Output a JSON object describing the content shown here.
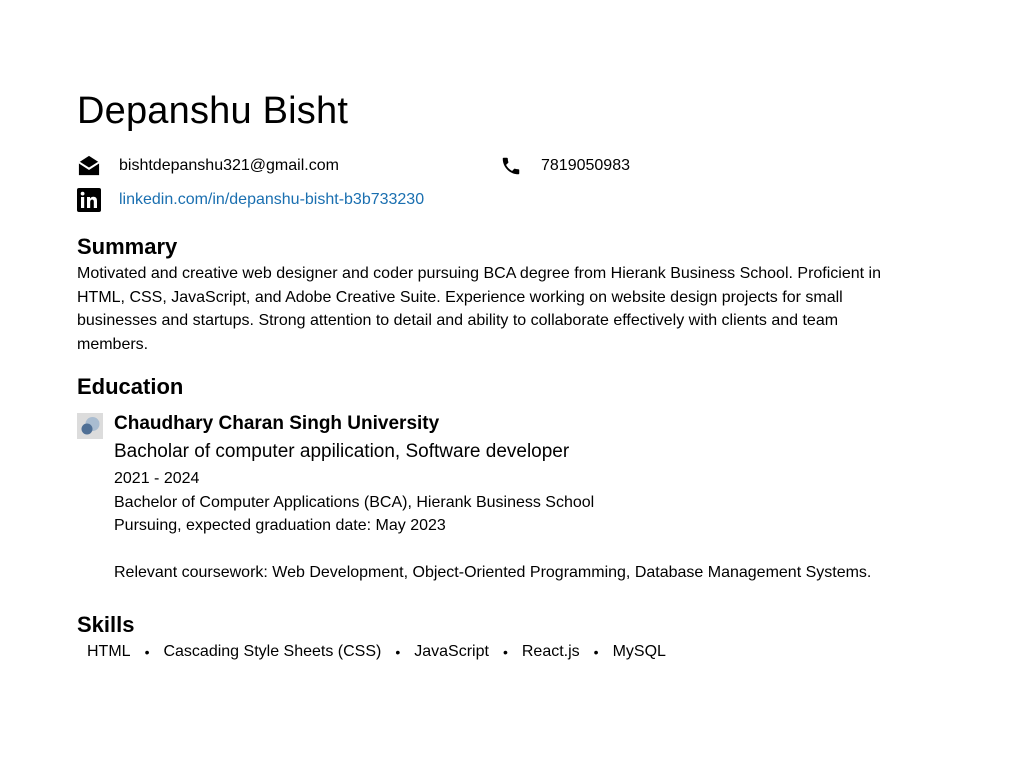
{
  "header": {
    "name": "Depanshu Bisht",
    "email": "bishtdepanshu321@gmail.com",
    "phone": "7819050983",
    "linkedin": "linkedin.com/in/depanshu-bisht-b3b733230",
    "link_color": "#1a6fb0",
    "icons": [
      "envelope-icon",
      "phone-icon",
      "linkedin-icon"
    ]
  },
  "summary": {
    "heading": "Summary",
    "text": "Motivated and creative web designer and coder pursuing BCA degree from Hierank Business School. Proficient in HTML, CSS, JavaScript, and Adobe Creative Suite. Experience working on website design projects for small businesses and startups. Strong attention to detail and ability to collaborate effectively with clients and team members."
  },
  "education": {
    "heading": "Education",
    "school": "Chaudhary Charan Singh University",
    "degree": "Bacholar of computer appilication, Software developer",
    "years": "2021 - 2024",
    "line1": "Bachelor of Computer Applications (BCA), Hierank Business School",
    "line2": "Pursuing, expected graduation date: May 2023",
    "coursework": "Relevant coursework: Web Development, Object-Oriented Programming, Database Management Systems."
  },
  "skills": {
    "heading": "Skills",
    "items": [
      "HTML",
      "Cascading Style Sheets (CSS)",
      "JavaScript",
      "React.js",
      "MySQL"
    ]
  }
}
